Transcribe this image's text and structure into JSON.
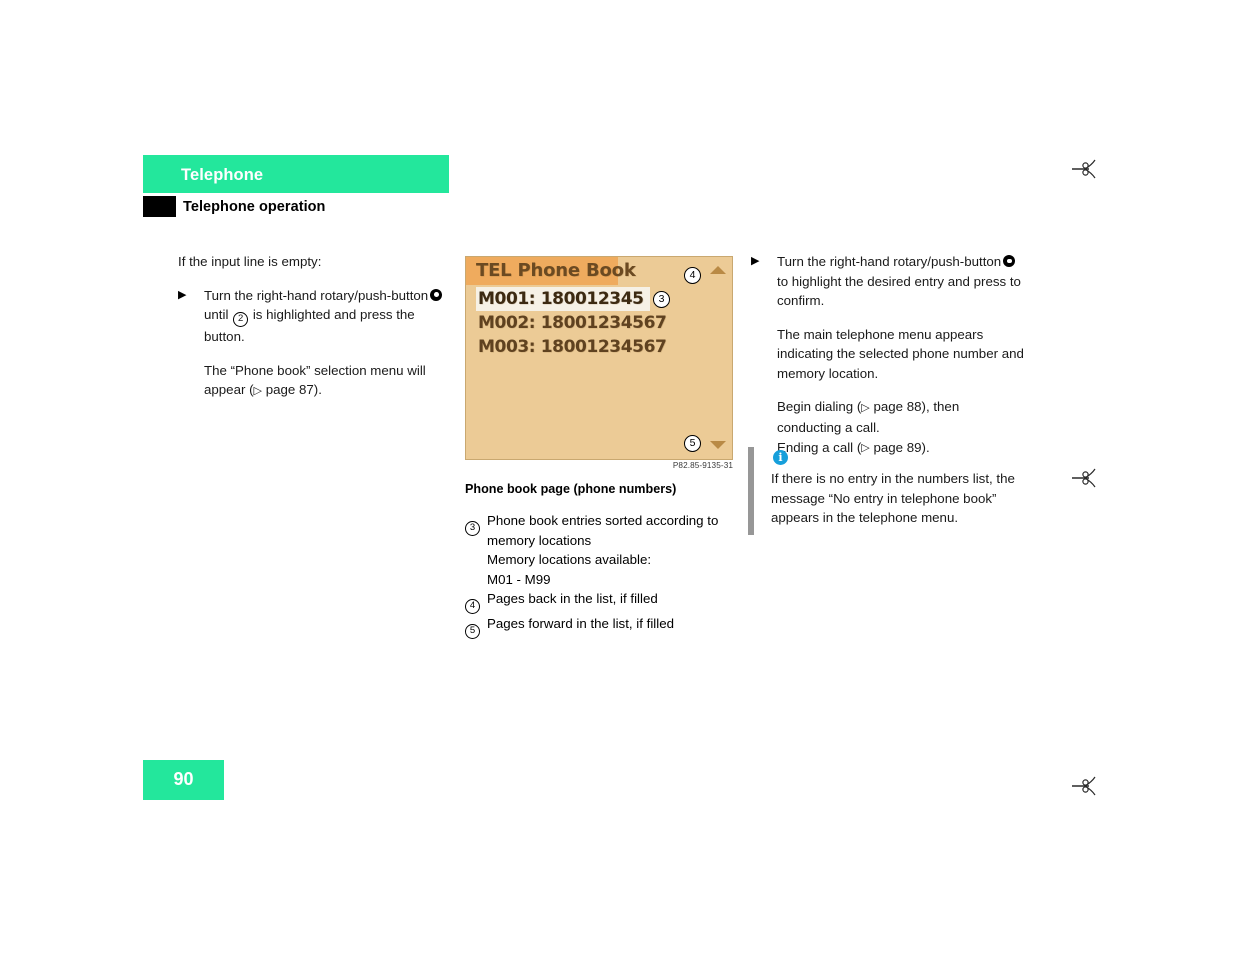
{
  "header": {
    "chapter": "Telephone",
    "section": "Telephone operation"
  },
  "left_column": {
    "intro": "If the input line is empty:",
    "step_1_part_a": "Turn the right-hand rotary/push-button",
    "step_1_part_b": "until",
    "step_1_circled_number": "2",
    "step_1_part_c": "is highlighted and press the button.",
    "result_part_a": "The “Phone book” selection menu will appear (",
    "result_page_ref": "page 87",
    "result_part_b": ")."
  },
  "figure": {
    "lcd_title": "TEL Phone Book",
    "rows": [
      "M001: 180012345",
      "M002: 18001234567",
      "M003: 18001234567"
    ],
    "selected_row_index": 0,
    "callouts": [
      "3",
      "4",
      "5"
    ],
    "part_number": "P82.85-9135-31",
    "caption": "Phone book page (phone numbers)",
    "arrow_up_icon": "triangle-up-icon",
    "arrow_down_icon": "triangle-down-icon",
    "colors": {
      "lcd_background": "#eccb96",
      "lcd_header_band": "#efab5e",
      "lcd_text": "#5f4220",
      "lcd_selected_background": "#f6f1e6"
    }
  },
  "legend": [
    {
      "number": "3",
      "lines": [
        "Phone book entries sorted according to",
        "memory locations",
        "Memory locations available:",
        "M01 - M99"
      ]
    },
    {
      "number": "4",
      "lines": [
        "Pages back in the list, if filled"
      ]
    },
    {
      "number": "5",
      "lines": [
        "Pages forward in the list, if filled"
      ]
    }
  ],
  "right_column": {
    "step_1_part_a": "Turn the right-hand rotary/push-button",
    "step_1_part_b": "to highlight the desired entry and press to confirm.",
    "result_1": "The main telephone menu appears indicating the selected phone number and memory location.",
    "result_2_part_a": "Begin dialing (",
    "result_2_page_ref": "page 88",
    "result_2_part_b": "), then conducting a call.",
    "result_3_part_a": "Ending a call (",
    "result_3_page_ref": "page 89",
    "result_3_part_b": ")."
  },
  "note": {
    "icon": "info-icon",
    "text": "If there is no entry in the numbers list, the message “No entry in telephone book” appears in the telephone menu.",
    "bar_color": "#979797",
    "icon_color": "#169fdb"
  },
  "footer": {
    "page_number": "90",
    "accent_color": "#23e79c"
  },
  "cut_marks": {
    "icon": "scissors-icon",
    "count": 3
  }
}
